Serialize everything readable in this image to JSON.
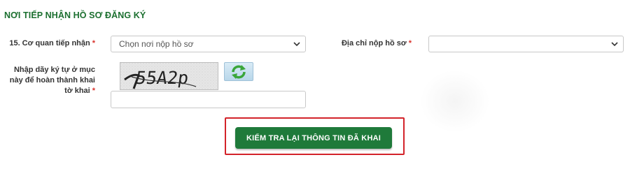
{
  "section": {
    "title": "NƠI TIẾP NHẬN HỒ SƠ ĐĂNG KÝ"
  },
  "agency": {
    "label": "15. Cơ quan tiếp nhận",
    "required_mark": "*",
    "selected": "Chọn nơi nộp hồ sơ",
    "icon": "chevron-down-icon"
  },
  "address": {
    "label": "Địa chỉ nộp hồ sơ",
    "required_mark": "*",
    "selected": "",
    "icon": "chevron-down-icon"
  },
  "captcha": {
    "label": "Nhập dãy ký tự ở mục này để hoàn thành khai tờ khai",
    "required_mark": "*",
    "code": "55A2p",
    "refresh_icon": "refresh-icon",
    "input_value": ""
  },
  "actions": {
    "submit_label": "KIỂM TRA LẠI THÔNG TIN ĐÃ KHAI"
  },
  "colors": {
    "section_title": "#1b6f2f",
    "button": "#1f7a3a",
    "required": "#d9322b",
    "highlight": "#d3232a"
  }
}
